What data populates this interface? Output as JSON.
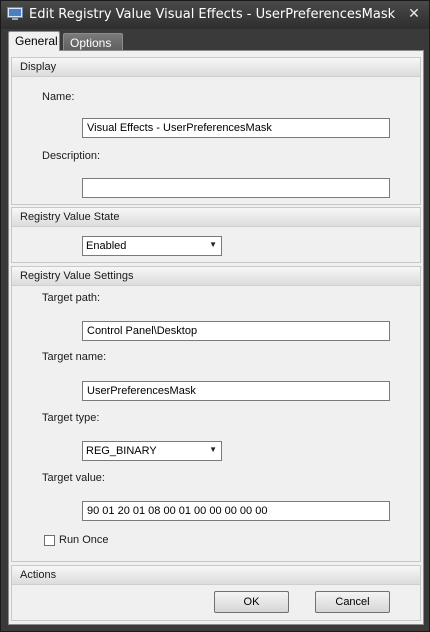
{
  "window": {
    "title": "Edit Registry Value Visual Effects - UserPreferencesMask"
  },
  "tabs": [
    {
      "label": "General"
    },
    {
      "label": "Options"
    }
  ],
  "display": {
    "header": "Display",
    "name_label": "Name:",
    "name_value": "Visual Effects - UserPreferencesMask",
    "description_label": "Description:",
    "description_value": ""
  },
  "state": {
    "header": "Registry Value State",
    "selected": "Enabled"
  },
  "settings": {
    "header": "Registry Value Settings",
    "target_path_label": "Target path:",
    "target_path_value": "Control Panel\\Desktop",
    "target_name_label": "Target name:",
    "target_name_value": "UserPreferencesMask",
    "target_type_label": "Target type:",
    "target_type_selected": "REG_BINARY",
    "target_value_label": "Target value:",
    "target_value_value": "90 01 20 01 08 00 01 00 00 00 00 00",
    "run_once_label": "Run Once",
    "run_once_checked": false
  },
  "actions": {
    "header": "Actions",
    "ok_label": "OK",
    "cancel_label": "Cancel"
  }
}
